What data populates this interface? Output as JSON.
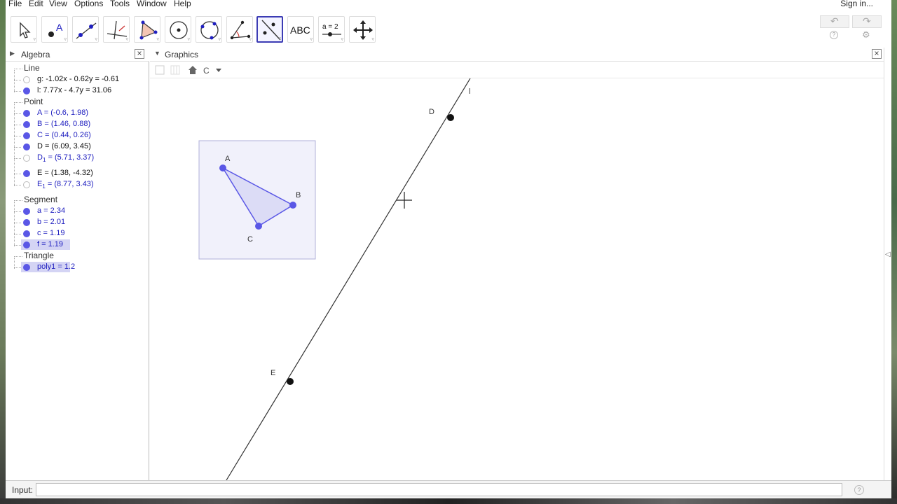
{
  "menu": [
    "File",
    "Edit",
    "View",
    "Options",
    "Tools",
    "Window",
    "Help"
  ],
  "signin": "Sign in...",
  "toolbar": {
    "tools": [
      {
        "name": "move-tool",
        "icon": "arrow-pointer-icon"
      },
      {
        "name": "point-tool",
        "icon": "point-icon",
        "label": "A"
      },
      {
        "name": "line-tool",
        "icon": "line-through-points-icon"
      },
      {
        "name": "perpendicular-line-tool",
        "icon": "perpendicular-line-icon"
      },
      {
        "name": "polygon-tool",
        "icon": "polygon-icon"
      },
      {
        "name": "circle-center-point-tool",
        "icon": "circle-center-icon"
      },
      {
        "name": "circle-three-points-tool",
        "icon": "circle-three-points-icon"
      },
      {
        "name": "angle-tool",
        "icon": "angle-icon"
      },
      {
        "name": "reflect-about-line-tool",
        "icon": "reflect-line-icon",
        "active": true
      },
      {
        "name": "text-tool",
        "icon": "text-icon",
        "label": "ABC"
      },
      {
        "name": "slider-tool",
        "icon": "slider-icon",
        "label": "a = 2"
      },
      {
        "name": "move-graphics-view-tool",
        "icon": "move-cross-icon"
      }
    ]
  },
  "algebra": {
    "title": "Algebra",
    "categories": [
      {
        "label": "Line",
        "items": [
          {
            "text": "g: -1.02x - 0.62y = -0.61",
            "visible": false,
            "color": "black"
          },
          {
            "text": "l: 7.77x - 4.7y = 31.06",
            "visible": true,
            "color": "black"
          }
        ]
      },
      {
        "label": "Point",
        "items": [
          {
            "text": "A = (-0.6, 1.98)",
            "visible": true,
            "color": "blue"
          },
          {
            "text": "B = (1.46, 0.88)",
            "visible": true,
            "color": "blue"
          },
          {
            "text": "C = (0.44, 0.26)",
            "visible": true,
            "color": "blue"
          },
          {
            "text": "D = (6.09, 3.45)",
            "visible": true,
            "color": "black"
          },
          {
            "text": "D",
            "sub": "1",
            "rest": " = (5.71, 3.37)",
            "visible": false,
            "color": "blue"
          },
          {
            "text": "E = (1.38, -4.32)",
            "visible": true,
            "color": "black"
          },
          {
            "text": "E",
            "sub": "1",
            "rest": " = (8.77, 3.43)",
            "visible": false,
            "color": "blue"
          }
        ]
      },
      {
        "label": "Segment",
        "items": [
          {
            "text": "a = 2.34",
            "visible": true,
            "color": "blue"
          },
          {
            "text": "b = 2.01",
            "visible": true,
            "color": "blue"
          },
          {
            "text": "c = 1.19",
            "visible": true,
            "color": "blue"
          },
          {
            "text": "f = 1.19",
            "visible": true,
            "color": "blue",
            "selected": true
          }
        ]
      },
      {
        "label": "Triangle",
        "items": [
          {
            "text": "poly1 = 1.2",
            "visible": true,
            "color": "blue",
            "selected": true
          }
        ]
      }
    ]
  },
  "graphics": {
    "title": "Graphics",
    "labels": {
      "A": "A",
      "B": "B",
      "C": "C",
      "D": "D",
      "E": "E",
      "line": "l"
    }
  },
  "inputbar": {
    "label": "Input:",
    "value": "",
    "placeholder": ""
  },
  "colors": {
    "accent": "#5a57e6",
    "active_tool": "#3c3cb4",
    "triangle_fill": "#dcdcf6"
  }
}
